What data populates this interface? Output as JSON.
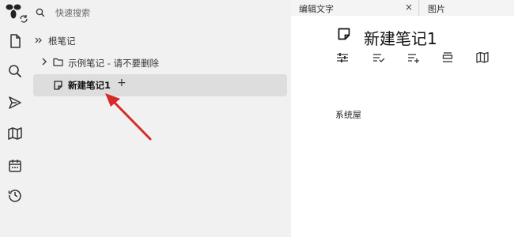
{
  "search": {
    "placeholder": "快速搜索"
  },
  "tree": {
    "root_label": "根笔记",
    "items": [
      {
        "label": "示例笔记 - 请不要删除",
        "expandable": true
      },
      {
        "label": "新建笔记1",
        "selected": true
      }
    ],
    "add_symbol": "+"
  },
  "sidebar": {
    "icons": [
      "logo-icon",
      "sync-icon",
      "note-icon",
      "search-icon",
      "send-icon",
      "map-icon",
      "calendar-icon",
      "history-icon"
    ]
  },
  "tabs": [
    {
      "label": "编辑文字",
      "close_symbol": "×"
    },
    {
      "label": "图片"
    }
  ],
  "note": {
    "title": "新建笔记1",
    "content": "系统屋"
  },
  "colors": {
    "arrow": "#d62a2a",
    "selected_row": "#dddddd",
    "pane_bg": "#f1f1f1"
  }
}
